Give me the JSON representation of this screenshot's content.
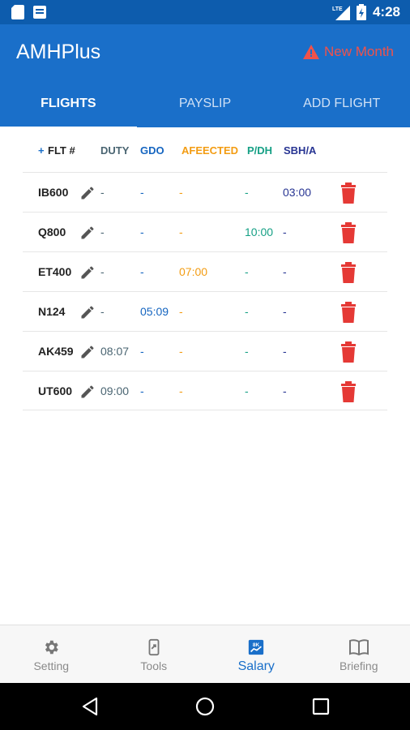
{
  "status_bar": {
    "network": "LTE",
    "time": "4:28"
  },
  "app_bar": {
    "title": "AMHPlus",
    "new_month_label": "New Month"
  },
  "tabs": [
    {
      "label": "FLIGHTS",
      "active": true
    },
    {
      "label": "PAYSLIP",
      "active": false
    },
    {
      "label": "ADD FLIGHT",
      "active": false
    }
  ],
  "table": {
    "headers": {
      "plus": "+",
      "flt": "FLT #",
      "duty": "DUTY",
      "gdo": "GDO",
      "affected": "AFEECTED",
      "pdh": "P/DH",
      "sbha": "SBH/A"
    },
    "rows": [
      {
        "flt": "IB600",
        "duty": "-",
        "gdo": "-",
        "affected": "-",
        "pdh": "-",
        "sbha": "03:00"
      },
      {
        "flt": "Q800",
        "duty": "-",
        "gdo": "-",
        "affected": "-",
        "pdh": "10:00",
        "sbha": "-"
      },
      {
        "flt": "ET400",
        "duty": "-",
        "gdo": "-",
        "affected": "07:00",
        "pdh": "-",
        "sbha": "-"
      },
      {
        "flt": "N124",
        "duty": "-",
        "gdo": "05:09",
        "affected": "-",
        "pdh": "-",
        "sbha": "-"
      },
      {
        "flt": "AK459",
        "duty": "08:07",
        "gdo": "-",
        "affected": "-",
        "pdh": "-",
        "sbha": "-"
      },
      {
        "flt": "UT600",
        "duty": "09:00",
        "gdo": "-",
        "affected": "-",
        "pdh": "-",
        "sbha": "-"
      }
    ]
  },
  "bottom_nav": [
    {
      "label": "Setting",
      "icon": "gear-icon",
      "active": false
    },
    {
      "label": "Tools",
      "icon": "tools-icon",
      "active": false
    },
    {
      "label": "Salary",
      "icon": "salary-icon",
      "active": true
    },
    {
      "label": "Briefing",
      "icon": "book-icon",
      "active": false
    }
  ],
  "colors": {
    "primary": "#1a6fc9",
    "status_bar": "#0d5cad",
    "alert": "#f0524a",
    "duty": "#4a6572",
    "gdo": "#1565c0",
    "affected": "#f39c12",
    "pdh": "#16a085",
    "sbha": "#283593",
    "delete": "#e53935"
  }
}
